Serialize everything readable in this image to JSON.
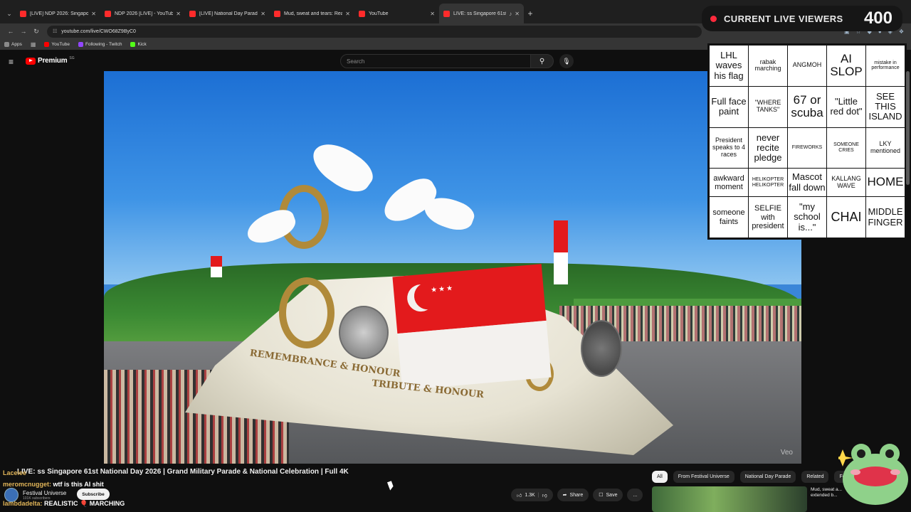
{
  "browser": {
    "tabs": [
      {
        "title": "[LIVE] NDP 2026: Singapore ce"
      },
      {
        "title": "NDP 2026 [LIVE] - YouTube"
      },
      {
        "title": "[LIVE] National Day Parade 202"
      },
      {
        "title": "Mud, sweat and tears: Reality cl"
      },
      {
        "title": "YouTube"
      },
      {
        "title": "LIVE: ss Singapore 61st"
      }
    ],
    "url": "youtube.com/live/CWO68Z9ByC0",
    "bookmarks": [
      {
        "label": "Apps",
        "color": "#8a8a8a"
      },
      {
        "label": "YouTube",
        "color": "#ff0000"
      },
      {
        "label": "Following - Twitch",
        "color": "#9146ff"
      },
      {
        "label": "Kick",
        "color": "#53fc18"
      }
    ]
  },
  "youtube": {
    "logo_text": "Premium",
    "logo_sup": "SG",
    "search_placeholder": "Search"
  },
  "overlay": {
    "live_label": "CURRENT LIVE VIEWERS",
    "live_count": "400",
    "bingo": [
      [
        "LHL waves his flag",
        "rabak marching",
        "ANGMOH",
        "AI SLOP",
        "mistake in performance"
      ],
      [
        "Full face paint",
        "\"WHERE TANKS\"",
        "67 or scuba",
        "\"Little red dot\"",
        "SEE THIS ISLAND"
      ],
      [
        "President speaks to 4 races",
        "never recite pledge",
        "FIREWORKS",
        "SOMEONE CRIES",
        "LKY mentioned"
      ],
      [
        "awkward moment",
        "HELIKOPTER HELIKOPTER",
        "Mascot fall down",
        "KALLANG WAVE",
        "HOME"
      ],
      [
        "someone faints",
        "SELFIE with president",
        "\"my school is...\"",
        "CHAI",
        "MIDDLE FINGER"
      ]
    ]
  },
  "video": {
    "float_text_left": "REMEMBRANCE & HONOUR",
    "float_text_right": "TRIBUTE & HONOUR",
    "watermark": "Veo",
    "title": "LIVE: ss Singapore 61st National Day 2026 | Grand Military Parade & National Celebration | Full 4K"
  },
  "chat": [
    {
      "user": "Lacelee",
      "message": ""
    },
    {
      "user": "meromcnugget:",
      "message": "wtf is this AI shit"
    },
    {
      "user": "lambdadelta:",
      "message": "REALISTIC 🎈 MARCHING"
    }
  ],
  "channel": {
    "name": "Festival Universe",
    "subscribers": "101K subscribers",
    "subscribe_label": "Subscribe"
  },
  "actions": {
    "like_count": "1.3K",
    "share_label": "Share",
    "save_label": "Save",
    "more_label": "..."
  },
  "chips": [
    "All",
    "From Festival Universe",
    "National Day Parade",
    "Related",
    "For you"
  ],
  "recommendation": {
    "title": "Mud, sweat a... extended b..."
  }
}
